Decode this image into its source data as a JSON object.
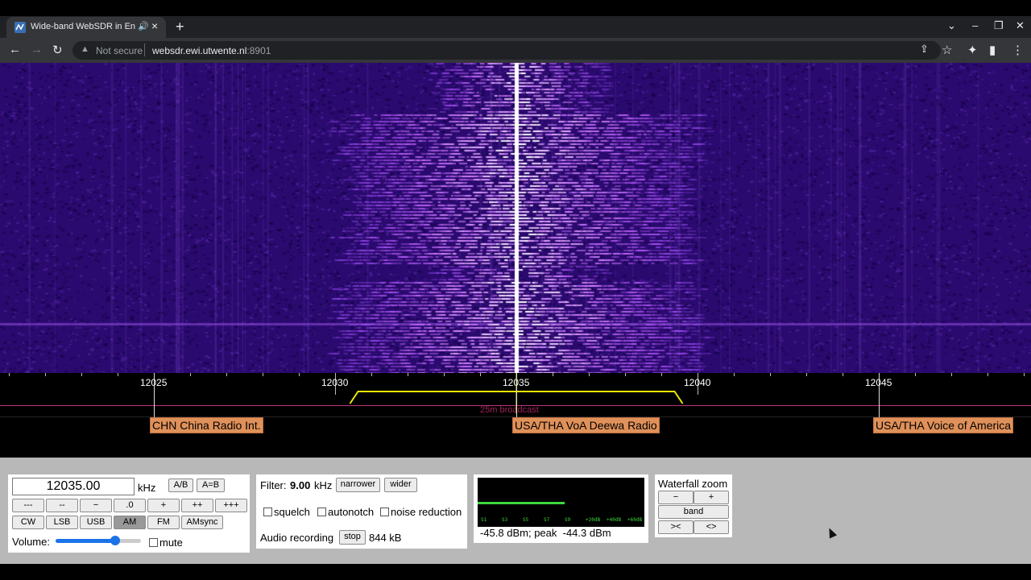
{
  "browser": {
    "tab_title": "Wide-band WebSDR in Ensch",
    "tab_audio_icon": "speaker-icon",
    "tab_close": "×",
    "new_tab": "+",
    "security_label": "Not secure",
    "url_host": "websdr.ewi.utwente.nl",
    "url_port": ":8901"
  },
  "scale": {
    "ticks": [
      {
        "label": "12025",
        "khz": 12025
      },
      {
        "label": "12030",
        "khz": 12030
      },
      {
        "label": "12035",
        "khz": 12035
      },
      {
        "label": "12040",
        "khz": 12040
      },
      {
        "label": "12045",
        "khz": 12045
      }
    ],
    "band_label": "25m broadcast",
    "stations": [
      {
        "label": "CHN China Radio Int.",
        "khz": 12025
      },
      {
        "label": "USA/THA VoA Deewa Radio",
        "khz": 12035
      },
      {
        "label": "USA/THA Voice of America",
        "khz": 12045
      }
    ]
  },
  "tuning": {
    "frequency": "12035.00",
    "unit": "kHz",
    "ab_label": "A/B",
    "a_eq_b_label": "A=B",
    "steps": [
      "---",
      "--",
      "−",
      ".0",
      "+",
      "++",
      "+++"
    ],
    "modes": [
      "CW",
      "LSB",
      "USB",
      "AM",
      "FM",
      "AMsync"
    ],
    "active_mode": "AM",
    "volume_label": "Volume:",
    "volume_level": 0.6,
    "mute_label": "mute"
  },
  "filter": {
    "label": "Filter:",
    "value": "9.00",
    "unit": "kHz",
    "narrower": "narrower",
    "wider": "wider",
    "squelch": "squelch",
    "autonotch": "autonotch",
    "noise_reduction": "noise reduction",
    "audio_recording": "Audio recording",
    "stop": "stop",
    "size": "844 kB"
  },
  "smeter": {
    "scale_labels": [
      "S1",
      "S3",
      "S5",
      "S7",
      "S9",
      "+20dB",
      "+40dB",
      "+60dB"
    ],
    "level_fraction": 0.62,
    "readout": "-45.8 dBm; peak  -44.3 dBm"
  },
  "zoom": {
    "title": "Waterfall zoom",
    "minus": "−",
    "plus": "+",
    "band": "band",
    "narrow": "><",
    "wide": "<>"
  },
  "colors": {
    "waterfall_bg": "#2a0a6e",
    "signal": "#ffffff",
    "passband": "#ffff00",
    "station_label": "#e0915a"
  }
}
